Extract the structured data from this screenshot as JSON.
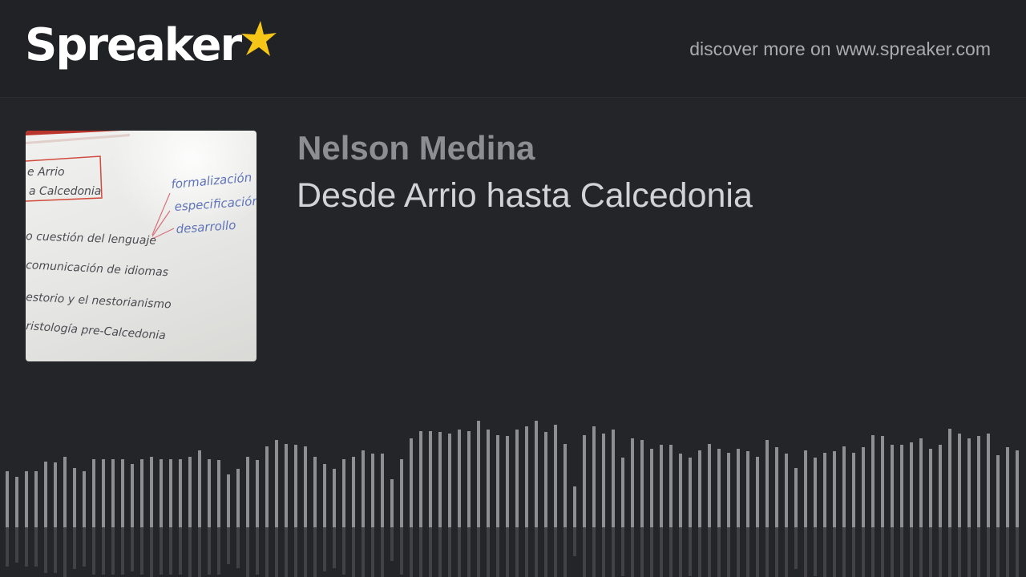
{
  "header": {
    "logo_text": "Spreaker",
    "discover_text": "discover more on www.spreaker.com"
  },
  "episode": {
    "author": "Nelson Medina",
    "title": "Desde Arrio hasta Calcedonia",
    "cover_lines": [
      "e Arrio",
      "a Calcedonia",
      "formalización",
      "especificación",
      "desarrollo",
      "o cuestión del lenguaje",
      "comunicación de idiomas",
      "estorio y el nestorianismo",
      "ristología pre-Calcedonia"
    ]
  },
  "colors": {
    "background": "#242529",
    "header": "#212226",
    "author": "#8d8e93",
    "title": "#d2d3d6",
    "star": "#f5c518",
    "wave": "#8e8f93"
  },
  "waveform": {
    "levels": [
      0.44,
      0.4,
      0.44,
      0.44,
      0.52,
      0.51,
      0.56,
      0.47,
      0.44,
      0.54,
      0.54,
      0.54,
      0.54,
      0.5,
      0.54,
      0.56,
      0.54,
      0.54,
      0.54,
      0.56,
      0.61,
      0.54,
      0.53,
      0.42,
      0.46,
      0.56,
      0.53,
      0.64,
      0.69,
      0.66,
      0.65,
      0.64,
      0.56,
      0.5,
      0.46,
      0.54,
      0.56,
      0.61,
      0.58,
      0.58,
      0.38,
      0.54,
      0.7,
      0.76,
      0.76,
      0.75,
      0.74,
      0.77,
      0.76,
      0.84,
      0.77,
      0.73,
      0.72,
      0.77,
      0.8,
      0.84,
      0.75,
      0.81,
      0.66,
      0.32,
      0.73,
      0.8,
      0.74,
      0.77,
      0.55,
      0.7,
      0.69,
      0.62,
      0.65,
      0.65,
      0.58,
      0.55,
      0.61,
      0.66,
      0.62,
      0.59,
      0.62,
      0.6,
      0.56,
      0.69,
      0.63,
      0.58,
      0.47,
      0.61,
      0.55,
      0.59,
      0.6,
      0.64,
      0.59,
      0.63,
      0.73,
      0.72,
      0.65,
      0.65,
      0.67,
      0.7,
      0.62,
      0.65,
      0.78,
      0.74,
      0.7,
      0.72,
      0.74,
      0.57,
      0.63,
      0.61,
      0.65
    ]
  }
}
